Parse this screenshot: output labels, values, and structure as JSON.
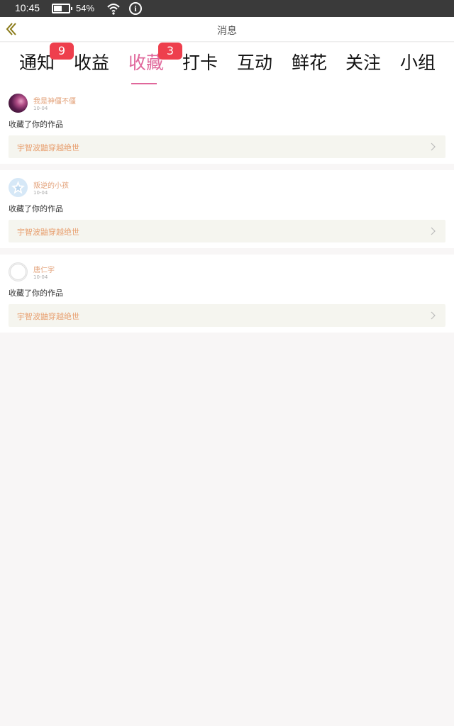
{
  "status": {
    "time": "10:45",
    "battery_pct": "54%",
    "battery_level": 0.54
  },
  "nav": {
    "title": "消息"
  },
  "tabs": [
    {
      "label": "通知",
      "badge": "9",
      "active": false
    },
    {
      "label": "收益",
      "badge": "",
      "active": false
    },
    {
      "label": "收藏",
      "badge": "3",
      "active": true
    },
    {
      "label": "打卡",
      "badge": "",
      "active": false
    },
    {
      "label": "互动",
      "badge": "",
      "active": false
    },
    {
      "label": "鲜花",
      "badge": "",
      "active": false
    },
    {
      "label": "关注",
      "badge": "",
      "active": false
    },
    {
      "label": "小组",
      "badge": "",
      "active": false
    }
  ],
  "messages": [
    {
      "user": "我是神僵不僵",
      "date": "10-04",
      "action": "收藏了你的作品",
      "work": "宇智波鼬穿越绝世"
    },
    {
      "user": "叛逆的小孩",
      "date": "10-04",
      "action": "收藏了你的作品",
      "work": "宇智波鼬穿越绝世"
    },
    {
      "user": "唐仁宇",
      "date": "10-04",
      "action": "收藏了你的作品",
      "work": "宇智波鼬穿越绝世"
    }
  ],
  "colors": {
    "accent": "#e0679b",
    "badge": "#ee3f4d",
    "username": "#e3a27a",
    "work_title": "#e8a070"
  }
}
